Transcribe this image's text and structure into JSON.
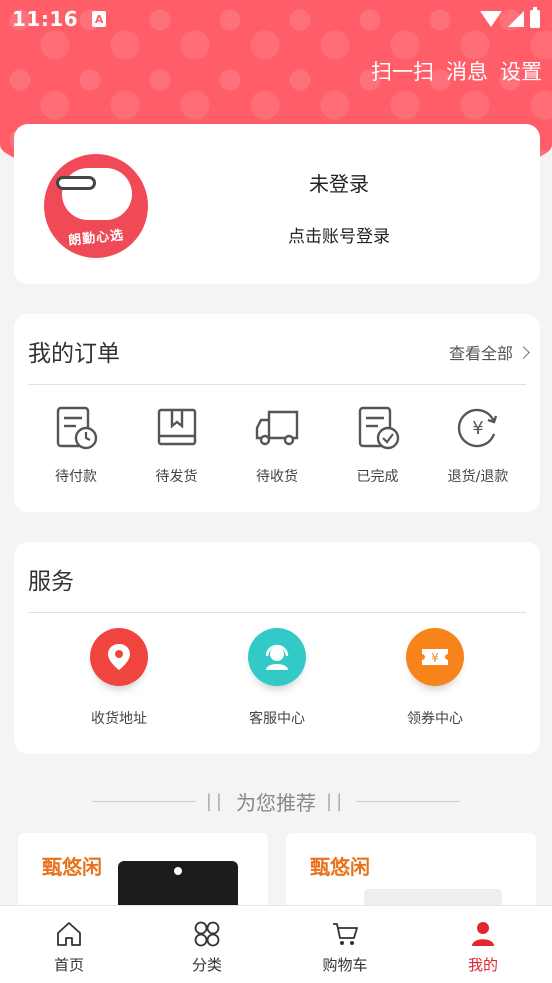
{
  "status_bar": {
    "time": "11:16",
    "app_badge": "A"
  },
  "header": {
    "actions": [
      "扫一扫",
      "消息",
      "设置"
    ]
  },
  "login": {
    "brand_text": "朗勤心选",
    "title": "未登录",
    "subtitle": "点击账号登录"
  },
  "orders": {
    "title": "我的订单",
    "view_all": "查看全部",
    "items": [
      {
        "label": "待付款",
        "icon": "pending-payment-icon"
      },
      {
        "label": "待发货",
        "icon": "package-icon"
      },
      {
        "label": "待收货",
        "icon": "truck-icon"
      },
      {
        "label": "已完成",
        "icon": "completed-doc-icon"
      },
      {
        "label": "退货/退款",
        "icon": "refund-icon"
      }
    ]
  },
  "services": {
    "title": "服务",
    "items": [
      {
        "label": "收货地址",
        "icon": "location-pin-icon",
        "color": "#f0453f"
      },
      {
        "label": "客服中心",
        "icon": "headset-icon",
        "color": "#33c9c6"
      },
      {
        "label": "领券中心",
        "icon": "coupon-icon",
        "color": "#f7841a"
      }
    ]
  },
  "recommend": {
    "title": "为您推荐",
    "bars_left": "||",
    "bars_right": "||"
  },
  "products": [
    {
      "brand": "甄悠闲"
    },
    {
      "brand": "甄悠闲"
    }
  ],
  "tabbar": {
    "items": [
      {
        "label": "首页",
        "icon": "home-icon"
      },
      {
        "label": "分类",
        "icon": "category-icon"
      },
      {
        "label": "购物车",
        "icon": "cart-icon"
      },
      {
        "label": "我的",
        "icon": "profile-icon"
      }
    ],
    "active": "我的"
  },
  "colors": {
    "brand": "#ff5d68",
    "active_tab": "#e0262f",
    "product_brand": "#e8731c"
  }
}
